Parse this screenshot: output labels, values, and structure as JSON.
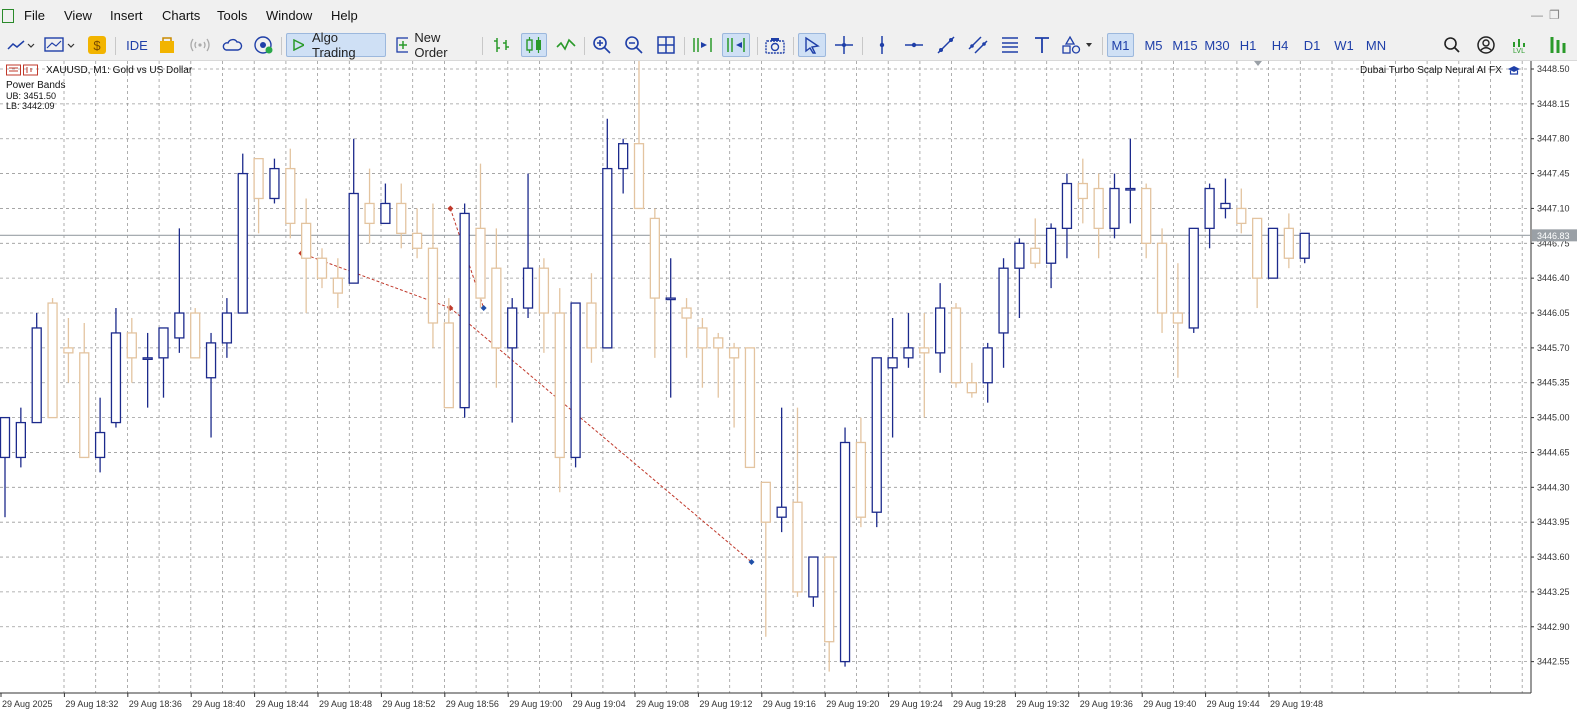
{
  "menu": {
    "items": [
      "File",
      "View",
      "Insert",
      "Charts",
      "Tools",
      "Window",
      "Help"
    ]
  },
  "toolbar": {
    "ide_label": "IDE",
    "algo_trading_label": "Algo Trading",
    "new_order_label": "New Order",
    "timeframes": [
      "M1",
      "M5",
      "M15",
      "M30",
      "H1",
      "H4",
      "D1",
      "W1",
      "MN"
    ],
    "selected_timeframe": "M1",
    "lvl_badge": "LVL"
  },
  "chart": {
    "symbol_title": "XAUUSD, M1:  Gold vs US Dollar",
    "indicator_name": "Power Bands",
    "upper_band": "UB: 3451.50",
    "lower_band": "LB: 3442.09",
    "expert_name": "Dubai Turbo Scalp Neural AI FX",
    "current_price_label": "3446.83",
    "colors": {
      "bull": "#1c2a8c",
      "bear": "#e3c4a0",
      "grid": "#9a9a9a",
      "price_line": "#9aa0a6",
      "trade_line": "#c0392b"
    }
  },
  "chart_data": {
    "type": "candlestick",
    "price_ticks": [
      "3448.50",
      "3448.15",
      "3447.80",
      "3447.45",
      "3447.10",
      "3446.75",
      "3446.40",
      "3446.05",
      "3445.70",
      "3445.35",
      "3445.00",
      "3444.65",
      "3444.30",
      "3443.95",
      "3443.60",
      "3443.25",
      "3442.90",
      "3442.55"
    ],
    "time_ticks": [
      "29 Aug 2025",
      "29 Aug 18:32",
      "29 Aug 18:36",
      "29 Aug 18:40",
      "29 Aug 18:44",
      "29 Aug 18:48",
      "29 Aug 18:52",
      "29 Aug 18:56",
      "29 Aug 19:00",
      "29 Aug 19:04",
      "29 Aug 19:08",
      "29 Aug 19:12",
      "29 Aug 19:16",
      "29 Aug 19:20",
      "29 Aug 19:24",
      "29 Aug 19:28",
      "29 Aug 19:32",
      "29 Aug 19:36",
      "29 Aug 19:40",
      "29 Aug 19:44",
      "29 Aug 19:48"
    ],
    "y_range": [
      3442.3,
      3448.6
    ],
    "current_price": 3446.83,
    "candles": [
      {
        "o": 3444.6,
        "h": 3445.0,
        "l": 3444.0,
        "c": 3445.0
      },
      {
        "o": 3444.6,
        "h": 3445.1,
        "l": 3444.5,
        "c": 3444.95
      },
      {
        "o": 3444.95,
        "h": 3446.05,
        "l": 3444.95,
        "c": 3445.9
      },
      {
        "o": 3446.15,
        "h": 3446.2,
        "l": 3445.0,
        "c": 3445.0
      },
      {
        "o": 3445.7,
        "h": 3446.0,
        "l": 3445.35,
        "c": 3445.65
      },
      {
        "o": 3445.65,
        "h": 3445.95,
        "l": 3444.6,
        "c": 3444.6
      },
      {
        "o": 3444.6,
        "h": 3445.2,
        "l": 3444.45,
        "c": 3444.85
      },
      {
        "o": 3444.95,
        "h": 3446.1,
        "l": 3444.9,
        "c": 3445.85
      },
      {
        "o": 3445.85,
        "h": 3446.0,
        "l": 3445.35,
        "c": 3445.6
      },
      {
        "o": 3445.6,
        "h": 3445.85,
        "l": 3445.1,
        "c": 3445.6
      },
      {
        "o": 3445.6,
        "h": 3445.9,
        "l": 3445.2,
        "c": 3445.9
      },
      {
        "o": 3445.8,
        "h": 3446.9,
        "l": 3445.65,
        "c": 3446.05
      },
      {
        "o": 3446.05,
        "h": 3446.1,
        "l": 3445.6,
        "c": 3445.6
      },
      {
        "o": 3445.4,
        "h": 3445.85,
        "l": 3444.8,
        "c": 3445.75
      },
      {
        "o": 3445.75,
        "h": 3446.2,
        "l": 3445.6,
        "c": 3446.05
      },
      {
        "o": 3446.05,
        "h": 3447.65,
        "l": 3446.05,
        "c": 3447.45
      },
      {
        "o": 3447.6,
        "h": 3447.6,
        "l": 3446.85,
        "c": 3447.2
      },
      {
        "o": 3447.2,
        "h": 3447.6,
        "l": 3447.15,
        "c": 3447.5
      },
      {
        "o": 3447.5,
        "h": 3447.7,
        "l": 3446.8,
        "c": 3446.95
      },
      {
        "o": 3446.95,
        "h": 3447.2,
        "l": 3446.05,
        "c": 3446.6
      },
      {
        "o": 3446.6,
        "h": 3446.7,
        "l": 3446.3,
        "c": 3446.4
      },
      {
        "o": 3446.4,
        "h": 3446.6,
        "l": 3446.1,
        "c": 3446.25
      },
      {
        "o": 3446.35,
        "h": 3447.8,
        "l": 3446.35,
        "c": 3447.25
      },
      {
        "o": 3447.15,
        "h": 3447.5,
        "l": 3446.75,
        "c": 3446.95
      },
      {
        "o": 3446.95,
        "h": 3447.35,
        "l": 3446.95,
        "c": 3447.15
      },
      {
        "o": 3447.15,
        "h": 3447.35,
        "l": 3446.7,
        "c": 3446.85
      },
      {
        "o": 3446.85,
        "h": 3447.1,
        "l": 3446.6,
        "c": 3446.7
      },
      {
        "o": 3446.7,
        "h": 3447.15,
        "l": 3445.7,
        "c": 3445.95
      },
      {
        "o": 3445.95,
        "h": 3446.2,
        "l": 3445.1,
        "c": 3445.1
      },
      {
        "o": 3445.1,
        "h": 3447.15,
        "l": 3445.0,
        "c": 3447.05
      },
      {
        "o": 3446.9,
        "h": 3447.55,
        "l": 3446.1,
        "c": 3446.2
      },
      {
        "o": 3446.5,
        "h": 3446.9,
        "l": 3445.3,
        "c": 3445.7
      },
      {
        "o": 3445.7,
        "h": 3446.2,
        "l": 3444.95,
        "c": 3446.1
      },
      {
        "o": 3446.1,
        "h": 3447.45,
        "l": 3446.0,
        "c": 3446.5
      },
      {
        "o": 3446.5,
        "h": 3446.6,
        "l": 3445.65,
        "c": 3446.05
      },
      {
        "o": 3446.05,
        "h": 3446.3,
        "l": 3444.25,
        "c": 3444.6
      },
      {
        "o": 3444.6,
        "h": 3446.15,
        "l": 3444.5,
        "c": 3446.15
      },
      {
        "o": 3446.15,
        "h": 3446.45,
        "l": 3445.55,
        "c": 3445.7
      },
      {
        "o": 3445.7,
        "h": 3448.0,
        "l": 3445.7,
        "c": 3447.5
      },
      {
        "o": 3447.5,
        "h": 3447.8,
        "l": 3447.25,
        "c": 3447.75
      },
      {
        "o": 3447.75,
        "h": 3448.6,
        "l": 3447.1,
        "c": 3447.1
      },
      {
        "o": 3447.0,
        "h": 3447.1,
        "l": 3445.6,
        "c": 3446.2
      },
      {
        "o": 3446.2,
        "h": 3446.6,
        "l": 3445.2,
        "c": 3446.2
      },
      {
        "o": 3446.1,
        "h": 3446.2,
        "l": 3445.6,
        "c": 3446.0
      },
      {
        "o": 3445.9,
        "h": 3446.0,
        "l": 3445.3,
        "c": 3445.7
      },
      {
        "o": 3445.8,
        "h": 3445.85,
        "l": 3445.2,
        "c": 3445.7
      },
      {
        "o": 3445.7,
        "h": 3445.75,
        "l": 3444.9,
        "c": 3445.6
      },
      {
        "o": 3445.7,
        "h": 3445.7,
        "l": 3444.5,
        "c": 3444.5
      },
      {
        "o": 3444.35,
        "h": 3444.35,
        "l": 3442.8,
        "c": 3443.95
      },
      {
        "o": 3444.0,
        "h": 3445.1,
        "l": 3443.85,
        "c": 3444.1
      },
      {
        "o": 3444.15,
        "h": 3445.1,
        "l": 3443.2,
        "c": 3443.25
      },
      {
        "o": 3443.2,
        "h": 3443.6,
        "l": 3443.1,
        "c": 3443.6
      },
      {
        "o": 3443.6,
        "h": 3443.6,
        "l": 3442.45,
        "c": 3442.75
      },
      {
        "o": 3442.55,
        "h": 3444.9,
        "l": 3442.5,
        "c": 3444.75
      },
      {
        "o": 3444.75,
        "h": 3445.0,
        "l": 3443.9,
        "c": 3444.0
      },
      {
        "o": 3444.05,
        "h": 3445.6,
        "l": 3443.9,
        "c": 3445.6
      },
      {
        "o": 3445.5,
        "h": 3446.0,
        "l": 3444.8,
        "c": 3445.6
      },
      {
        "o": 3445.6,
        "h": 3446.05,
        "l": 3445.5,
        "c": 3445.7
      },
      {
        "o": 3445.7,
        "h": 3446.05,
        "l": 3445.0,
        "c": 3445.65
      },
      {
        "o": 3445.65,
        "h": 3446.35,
        "l": 3445.45,
        "c": 3446.1
      },
      {
        "o": 3446.1,
        "h": 3446.15,
        "l": 3445.3,
        "c": 3445.35
      },
      {
        "o": 3445.35,
        "h": 3445.55,
        "l": 3445.2,
        "c": 3445.25
      },
      {
        "o": 3445.35,
        "h": 3445.75,
        "l": 3445.15,
        "c": 3445.7
      },
      {
        "o": 3445.85,
        "h": 3446.6,
        "l": 3445.5,
        "c": 3446.5
      },
      {
        "o": 3446.5,
        "h": 3446.8,
        "l": 3446.0,
        "c": 3446.75
      },
      {
        "o": 3446.7,
        "h": 3447.0,
        "l": 3446.5,
        "c": 3446.55
      },
      {
        "o": 3446.55,
        "h": 3446.95,
        "l": 3446.3,
        "c": 3446.9
      },
      {
        "o": 3446.9,
        "h": 3447.45,
        "l": 3446.6,
        "c": 3447.35
      },
      {
        "o": 3447.35,
        "h": 3447.6,
        "l": 3446.95,
        "c": 3447.2
      },
      {
        "o": 3447.3,
        "h": 3447.45,
        "l": 3446.6,
        "c": 3446.9
      },
      {
        "o": 3446.9,
        "h": 3447.45,
        "l": 3446.8,
        "c": 3447.3
      },
      {
        "o": 3447.3,
        "h": 3447.8,
        "l": 3446.95,
        "c": 3447.3
      },
      {
        "o": 3447.3,
        "h": 3447.35,
        "l": 3446.6,
        "c": 3446.75
      },
      {
        "o": 3446.75,
        "h": 3446.9,
        "l": 3445.85,
        "c": 3446.05
      },
      {
        "o": 3446.05,
        "h": 3446.55,
        "l": 3445.4,
        "c": 3445.95
      },
      {
        "o": 3445.9,
        "h": 3446.9,
        "l": 3445.85,
        "c": 3446.9
      },
      {
        "o": 3446.9,
        "h": 3447.35,
        "l": 3446.7,
        "c": 3447.3
      },
      {
        "o": 3447.1,
        "h": 3447.4,
        "l": 3447.0,
        "c": 3447.15
      },
      {
        "o": 3447.1,
        "h": 3447.3,
        "l": 3446.85,
        "c": 3446.95
      },
      {
        "o": 3447.0,
        "h": 3447.0,
        "l": 3446.1,
        "c": 3446.4
      },
      {
        "o": 3446.4,
        "h": 3446.9,
        "l": 3446.4,
        "c": 3446.9
      },
      {
        "o": 3446.9,
        "h": 3447.05,
        "l": 3446.5,
        "c": 3446.6
      },
      {
        "o": 3446.6,
        "h": 3446.85,
        "l": 3446.55,
        "c": 3446.85
      }
    ],
    "trade_markers": [
      {
        "x_index": 18.7,
        "y": 3446.65,
        "kind": "sell"
      },
      {
        "x_index": 28.1,
        "y": 3447.1,
        "kind": "sell"
      },
      {
        "x_index": 28.1,
        "y": 3446.1,
        "kind": "sell"
      },
      {
        "x_index": 30.2,
        "y": 3446.1,
        "kind": "buy"
      },
      {
        "x_index": 47.1,
        "y": 3443.55,
        "kind": "buy"
      }
    ],
    "trade_lines": [
      {
        "from": [
          18.7,
          3446.65
        ],
        "to": [
          28.1,
          3446.1
        ]
      },
      {
        "from": [
          28.1,
          3447.1
        ],
        "to": [
          30.2,
          3446.1
        ]
      },
      {
        "from": [
          28.1,
          3446.1
        ],
        "to": [
          47.1,
          3443.55
        ]
      }
    ]
  }
}
